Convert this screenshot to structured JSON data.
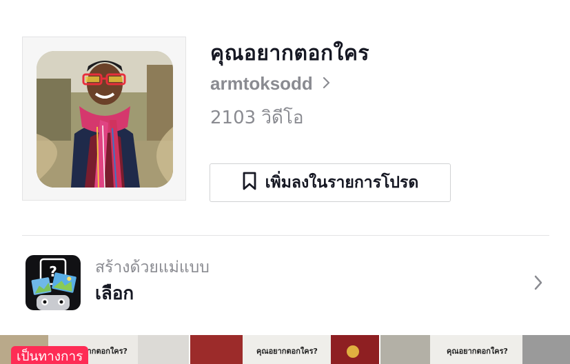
{
  "header": {
    "title": "คุณอยากตอกใคร",
    "username": "armtoksodd",
    "video_count": "2103 วิดีโอ"
  },
  "favorite_button": {
    "label": "เพิ่มลงในรายการโปรด",
    "icon": "bookmark-icon"
  },
  "template": {
    "caption": "สร้างด้วยแม่แบบ",
    "name": "เลือก",
    "icon": "question-photo-icon"
  },
  "video_strip": {
    "badge": "เป็นทางการ",
    "thumbnail_texts": [
      "คุณอยากตอกใคร?",
      "คุณอยากตอกใคร?",
      "คุณอยากตอกใคร?"
    ]
  },
  "colors": {
    "text_primary": "#161823",
    "text_secondary": "#8a8b91",
    "border": "#d0d1d3",
    "badge": "#fe2c55"
  }
}
